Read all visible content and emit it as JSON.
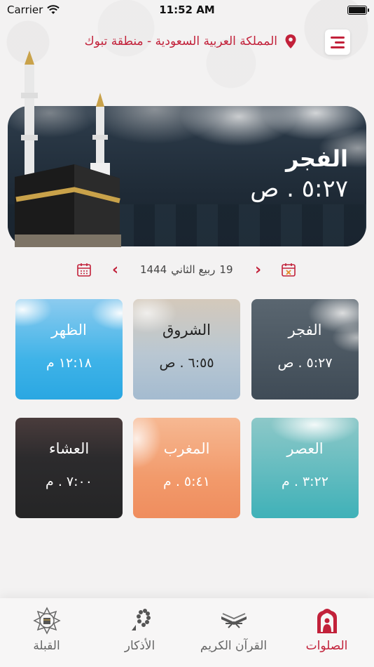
{
  "status_bar": {
    "carrier": "Carrier",
    "time": "11:52 AM"
  },
  "header": {
    "location": "المملكة العربية السعودية - منطقة تبوك"
  },
  "hero": {
    "prayer_name": "الفجر",
    "prayer_time": "٥:٢٧ . ص"
  },
  "date_nav": {
    "day": "19",
    "month": "ربيع الثاني",
    "year": "1444"
  },
  "prayers": [
    {
      "name": "الفجر",
      "time": "٥:٢٧ . ص"
    },
    {
      "name": "الشروق",
      "time": "٦:٥٥ . ص"
    },
    {
      "name": "الظهر",
      "time": "١٢:١٨ م"
    },
    {
      "name": "العصر",
      "time": "٣:٢٢ . م"
    },
    {
      "name": "المغرب",
      "time": "٥:٤١ . م"
    },
    {
      "name": "العشاء",
      "time": "٧:٠٠ . م"
    }
  ],
  "bottom_nav": {
    "prayers": "الصلوات",
    "quran": "القرآن الكريم",
    "azkar": "الأذكار",
    "qibla": "القبلة"
  },
  "colors": {
    "accent": "#c2213a"
  }
}
